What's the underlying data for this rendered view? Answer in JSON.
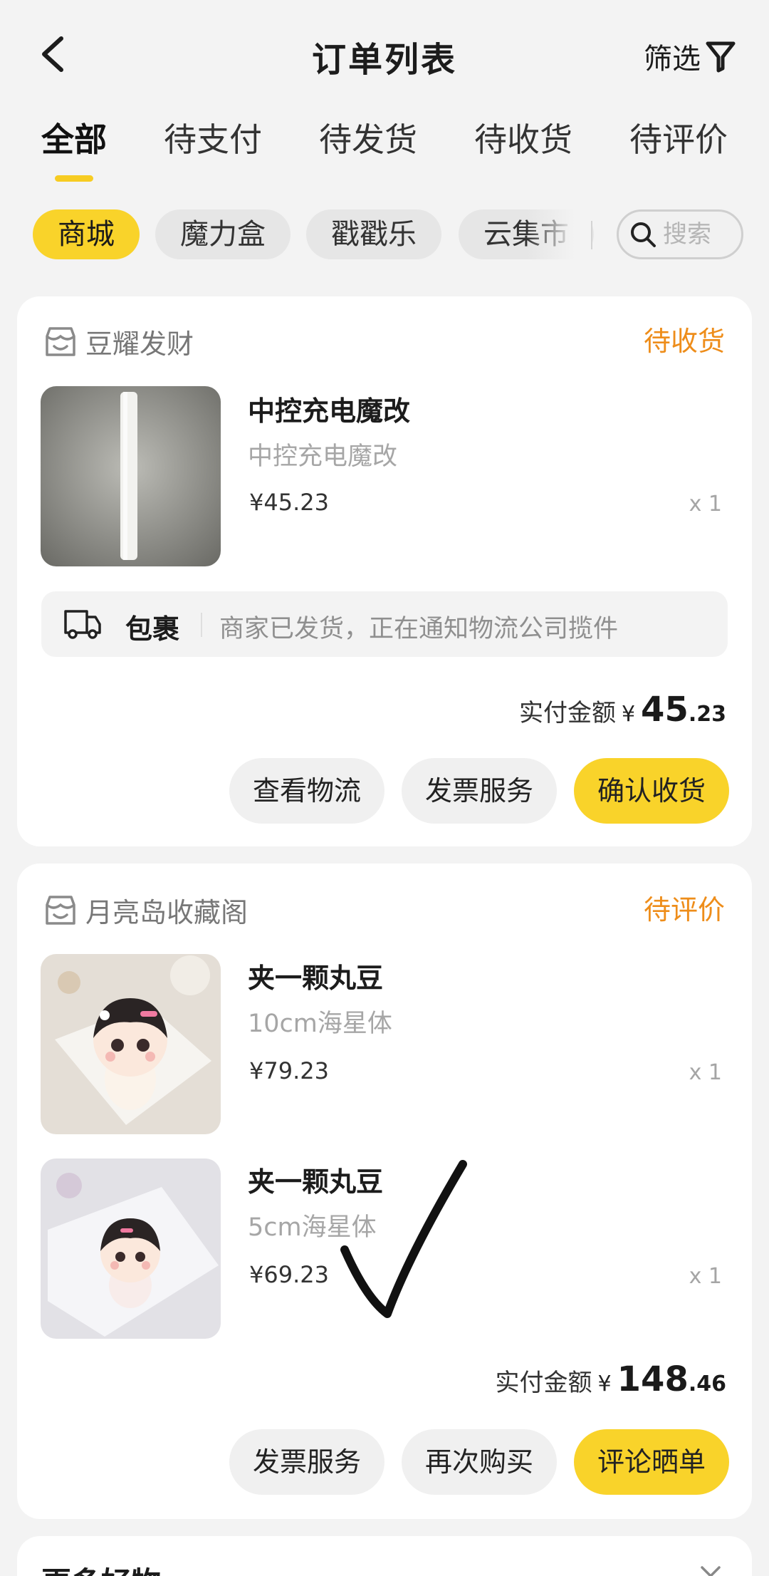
{
  "header": {
    "title": "订单列表",
    "filter_label": "筛选",
    "back_icon": "chevron-left-icon",
    "filter_icon": "funnel-icon"
  },
  "tabs": [
    {
      "label": "全部",
      "active": true
    },
    {
      "label": "待支付",
      "active": false
    },
    {
      "label": "待发货",
      "active": false
    },
    {
      "label": "待收货",
      "active": false
    },
    {
      "label": "待评价",
      "active": false
    }
  ],
  "categories": [
    {
      "label": "商城",
      "active": true
    },
    {
      "label": "魔力盒",
      "active": false
    },
    {
      "label": "戳戳乐",
      "active": false
    },
    {
      "label": "云集市",
      "active": false
    }
  ],
  "search": {
    "placeholder": "搜索"
  },
  "orders": [
    {
      "store": "豆耀发财",
      "status": "待收货",
      "items": [
        {
          "name": "中控充电魔改",
          "spec": "中控充电魔改",
          "price": "¥45.23",
          "qty": "x 1",
          "image": "white-stick-photo"
        }
      ],
      "package": {
        "title": "包裹",
        "message": "商家已发货，正在通知物流公司揽件",
        "icon": "truck-icon"
      },
      "paid": {
        "label": "实付金额",
        "currency": "¥",
        "integer": "45",
        "decimal": ".23"
      },
      "buttons": [
        "查看物流",
        "发票服务",
        "确认收货"
      ]
    },
    {
      "store": "月亮岛收藏阁",
      "status": "待评价",
      "items": [
        {
          "name": "夹一颗丸豆",
          "spec": "10cm海星体",
          "price": "¥79.23",
          "qty": "x 1",
          "image": "plush-doll-photo"
        },
        {
          "name": "夹一颗丸豆",
          "spec": "5cm海星体",
          "price": "¥69.23",
          "qty": "x 1",
          "image": "plush-doll-photo"
        }
      ],
      "paid": {
        "label": "实付金额",
        "currency": "¥",
        "integer": "148",
        "decimal": ".46"
      },
      "buttons": [
        "发票服务",
        "再次购买",
        "评论晒单"
      ]
    }
  ],
  "more_section": {
    "title": "更多好物"
  },
  "colors": {
    "accent": "#f9d32a",
    "status": "#ee8d1a",
    "background": "#f3f3f3"
  }
}
